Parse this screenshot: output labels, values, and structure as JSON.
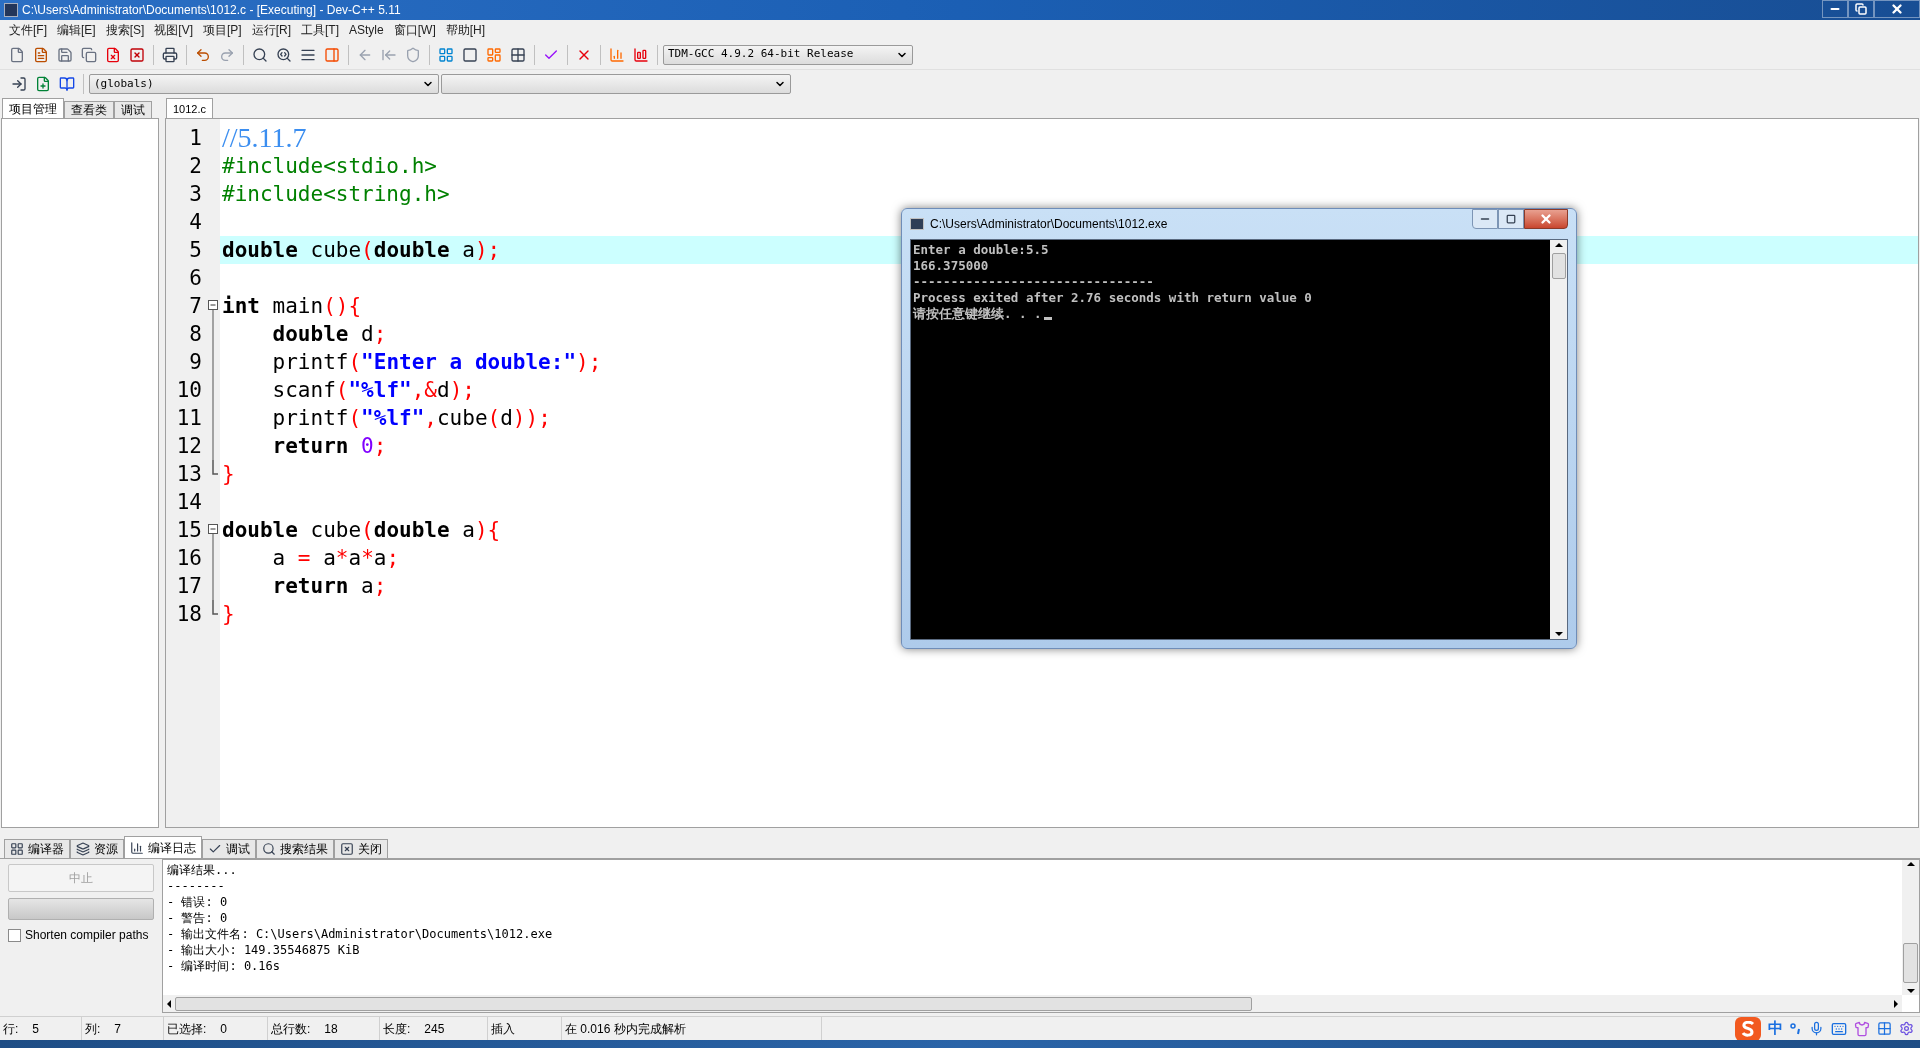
{
  "window": {
    "title": "C:\\Users\\Administrator\\Documents\\1012.c - [Executing] - Dev-C++ 5.11"
  },
  "menu": [
    "文件[F]",
    "编辑[E]",
    "搜索[S]",
    "视图[V]",
    "项目[P]",
    "运行[R]",
    "工具[T]",
    "AStyle",
    "窗口[W]",
    "帮助[H]"
  ],
  "compiler_select": {
    "value": "TDM-GCC 4.9.2 64-bit Release"
  },
  "scope_select": {
    "value": "(globals)"
  },
  "left_tabs": [
    {
      "label": "项目管理",
      "selected": true
    },
    {
      "label": "查看类",
      "selected": false
    },
    {
      "label": "调试",
      "selected": false
    }
  ],
  "editor_tabs": [
    {
      "label": "1012.c",
      "selected": true
    }
  ],
  "code": [
    {
      "n": "1",
      "kind": "plain",
      "current": false,
      "tokens": [
        {
          "kind": "comment",
          "t": "//5.11.7"
        }
      ]
    },
    {
      "n": "2",
      "kind": "plain",
      "current": false,
      "tokens": [
        {
          "kind": "preproc",
          "t": "#include<stdio.h>"
        }
      ]
    },
    {
      "n": "3",
      "kind": "plain",
      "current": false,
      "tokens": [
        {
          "kind": "preproc",
          "t": "#include<string.h>"
        }
      ]
    },
    {
      "n": "4",
      "kind": "plain",
      "current": false
    },
    {
      "n": "5",
      "kind": "plain",
      "current": true,
      "tokens": [
        {
          "kind": "keyword",
          "t": "double"
        },
        {
          "kind": "plain",
          "t": " cube"
        },
        {
          "kind": "symbol",
          "t": "("
        },
        {
          "kind": "keyword",
          "t": "double"
        },
        {
          "kind": "plain",
          "t": " a"
        },
        {
          "kind": "symbol",
          "t": ");"
        }
      ]
    },
    {
      "n": "6",
      "kind": "plain",
      "current": false
    },
    {
      "n": "7",
      "kind": "start",
      "current": false,
      "tokens": [
        {
          "kind": "keyword",
          "t": "int"
        },
        {
          "kind": "plain",
          "t": " main"
        },
        {
          "kind": "symbol",
          "t": "(){"
        }
      ]
    },
    {
      "n": "8",
      "kind": "body",
      "current": false,
      "tokens": [
        {
          "kind": "keyword",
          "t": "    double"
        },
        {
          "kind": "plain",
          "t": " d"
        },
        {
          "kind": "symbol",
          "t": ";"
        }
      ]
    },
    {
      "n": "9",
      "kind": "body",
      "current": false,
      "tokens": [
        {
          "kind": "plain",
          "t": "    printf"
        },
        {
          "kind": "symbol",
          "t": "("
        },
        {
          "kind": "string",
          "t": "\"Enter a double:\""
        },
        {
          "kind": "symbol",
          "t": ");"
        }
      ]
    },
    {
      "n": "10",
      "kind": "body",
      "current": false,
      "tokens": [
        {
          "kind": "plain",
          "t": "    scanf"
        },
        {
          "kind": "symbol",
          "t": "("
        },
        {
          "kind": "string",
          "t": "\"%lf\""
        },
        {
          "kind": "symbol",
          "t": ",&"
        },
        {
          "kind": "plain",
          "t": "d"
        },
        {
          "kind": "symbol",
          "t": ");"
        }
      ]
    },
    {
      "n": "11",
      "kind": "body",
      "current": false,
      "tokens": [
        {
          "kind": "plain",
          "t": "    printf"
        },
        {
          "kind": "symbol",
          "t": "("
        },
        {
          "kind": "string",
          "t": "\"%lf\""
        },
        {
          "kind": "symbol",
          "t": ","
        },
        {
          "kind": "plain",
          "t": "cube"
        },
        {
          "kind": "symbol",
          "t": "("
        },
        {
          "kind": "plain",
          "t": "d"
        },
        {
          "kind": "symbol",
          "t": "));"
        }
      ]
    },
    {
      "n": "12",
      "kind": "body",
      "current": false,
      "tokens": [
        {
          "kind": "keyword",
          "t": "    return"
        },
        {
          "kind": "number",
          "t": " 0"
        },
        {
          "kind": "symbol",
          "t": ";"
        }
      ]
    },
    {
      "n": "13",
      "kind": "end",
      "current": false,
      "tokens": [
        {
          "kind": "symbol",
          "t": "}"
        }
      ]
    },
    {
      "n": "14",
      "kind": "plain",
      "current": false
    },
    {
      "n": "15",
      "kind": "start",
      "current": false,
      "tokens": [
        {
          "kind": "keyword",
          "t": "double"
        },
        {
          "kind": "plain",
          "t": " cube"
        },
        {
          "kind": "symbol",
          "t": "("
        },
        {
          "kind": "keyword",
          "t": "double"
        },
        {
          "kind": "plain",
          "t": " a"
        },
        {
          "kind": "symbol",
          "t": "){"
        }
      ]
    },
    {
      "n": "16",
      "kind": "body",
      "current": false,
      "tokens": [
        {
          "kind": "plain",
          "t": "    a "
        },
        {
          "kind": "symbol",
          "t": "="
        },
        {
          "kind": "plain",
          "t": " a"
        },
        {
          "kind": "symbol",
          "t": "*"
        },
        {
          "kind": "plain",
          "t": "a"
        },
        {
          "kind": "symbol",
          "t": "*"
        },
        {
          "kind": "plain",
          "t": "a"
        },
        {
          "kind": "symbol",
          "t": ";"
        }
      ]
    },
    {
      "n": "17",
      "kind": "body",
      "current": false,
      "tokens": [
        {
          "kind": "keyword",
          "t": "    return"
        },
        {
          "kind": "plain",
          "t": " a"
        },
        {
          "kind": "symbol",
          "t": ";"
        }
      ]
    },
    {
      "n": "18",
      "kind": "end",
      "current": false,
      "tokens": [
        {
          "kind": "symbol",
          "t": "}"
        }
      ]
    }
  ],
  "console": {
    "title": "C:\\Users\\Administrator\\Documents\\1012.exe",
    "lines": [
      "Enter a double:5.5",
      "166.375000",
      "--------------------------------",
      "Process exited after 2.76 seconds with return value 0",
      "请按任意键继续. . ."
    ]
  },
  "bottom_tabs": [
    {
      "label": "编译器",
      "selected": false
    },
    {
      "label": "资源",
      "selected": false
    },
    {
      "label": "编译日志",
      "selected": true
    },
    {
      "label": "调试",
      "selected": false
    },
    {
      "label": "搜索结果",
      "selected": false
    },
    {
      "label": "关闭",
      "selected": false
    }
  ],
  "abort_button": {
    "label": "中止",
    "disabled": true
  },
  "progress": {
    "level": 0
  },
  "shorten_paths": {
    "label": "Shorten compiler paths",
    "checked": false
  },
  "log": [
    "编译结果...",
    "--------",
    "- 错误: 0",
    "- 警告: 0",
    "- 输出文件名: C:\\Users\\Administrator\\Documents\\1012.exe",
    "- 输出大小: 149.35546875 KiB",
    "- 编译时间: 0.16s"
  ],
  "status_bar": [
    {
      "label": "行:",
      "value": "5"
    },
    {
      "label": "列:",
      "value": "7"
    },
    {
      "label": "已选择:",
      "value": "0"
    },
    {
      "label": "总行数:",
      "value": "18"
    },
    {
      "label": "长度:",
      "value": "245"
    },
    {
      "label": "插入"
    },
    {
      "label": "在 0.016 秒内完成解析"
    }
  ],
  "ime": {
    "mode": "中"
  }
}
